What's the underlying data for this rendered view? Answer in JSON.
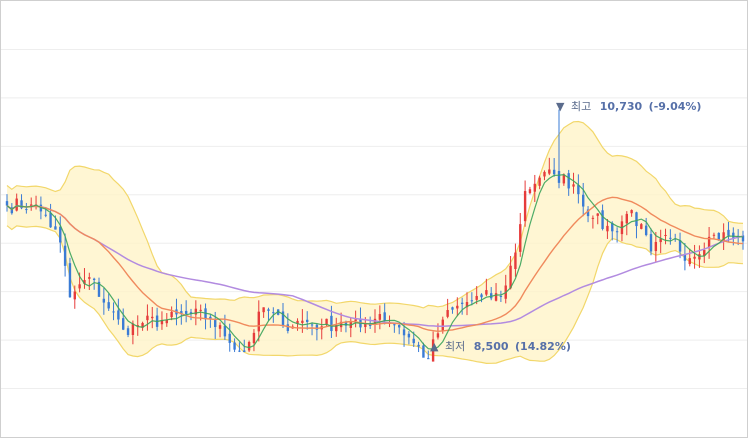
{
  "chart_data": {
    "type": "candlestick",
    "title": "",
    "xlabel": "",
    "ylabel": "",
    "ylim": [
      7800,
      11700
    ],
    "grid": true,
    "annotations": {
      "high": {
        "marker": "▼",
        "label": "최고",
        "value": "10,730",
        "change": "(-9.04%)",
        "price": 10730,
        "index": 114
      },
      "low": {
        "marker": "▲",
        "label": "최저",
        "value": "8,500",
        "change": "(14.82%)",
        "price": 8500,
        "index": 87
      }
    },
    "colors": {
      "up": "#e63b3b",
      "down": "#3a7bd5",
      "band_fill": "#fff3c4",
      "band_line": "#f2d76a",
      "ma_short": "#3aa35a",
      "ma_mid": "#f08a5d",
      "ma_long": "#b28be0",
      "grid": "#eeeeee"
    },
    "close_anchors": [
      [
        0,
        9870
      ],
      [
        5,
        9880
      ],
      [
        8,
        9780
      ],
      [
        11,
        9540
      ],
      [
        13,
        9050
      ],
      [
        17,
        9230
      ],
      [
        21,
        8950
      ],
      [
        24,
        8760
      ],
      [
        28,
        8820
      ],
      [
        33,
        8850
      ],
      [
        38,
        8900
      ],
      [
        42,
        8860
      ],
      [
        45,
        8700
      ],
      [
        49,
        8560
      ],
      [
        53,
        8960
      ],
      [
        57,
        8800
      ],
      [
        61,
        8840
      ],
      [
        65,
        8790
      ],
      [
        69,
        8830
      ],
      [
        73,
        8780
      ],
      [
        77,
        8900
      ],
      [
        81,
        8780
      ],
      [
        84,
        8640
      ],
      [
        87,
        8500
      ],
      [
        90,
        8850
      ],
      [
        94,
        8990
      ],
      [
        98,
        9050
      ],
      [
        102,
        9060
      ],
      [
        105,
        9450
      ],
      [
        107,
        10000
      ],
      [
        110,
        10120
      ],
      [
        113,
        10150
      ],
      [
        117,
        10060
      ],
      [
        121,
        9760
      ],
      [
        125,
        9640
      ],
      [
        129,
        9830
      ],
      [
        133,
        9460
      ],
      [
        137,
        9580
      ],
      [
        141,
        9400
      ],
      [
        145,
        9590
      ],
      [
        149,
        9600
      ],
      [
        152,
        9550
      ]
    ],
    "count": 153
  }
}
